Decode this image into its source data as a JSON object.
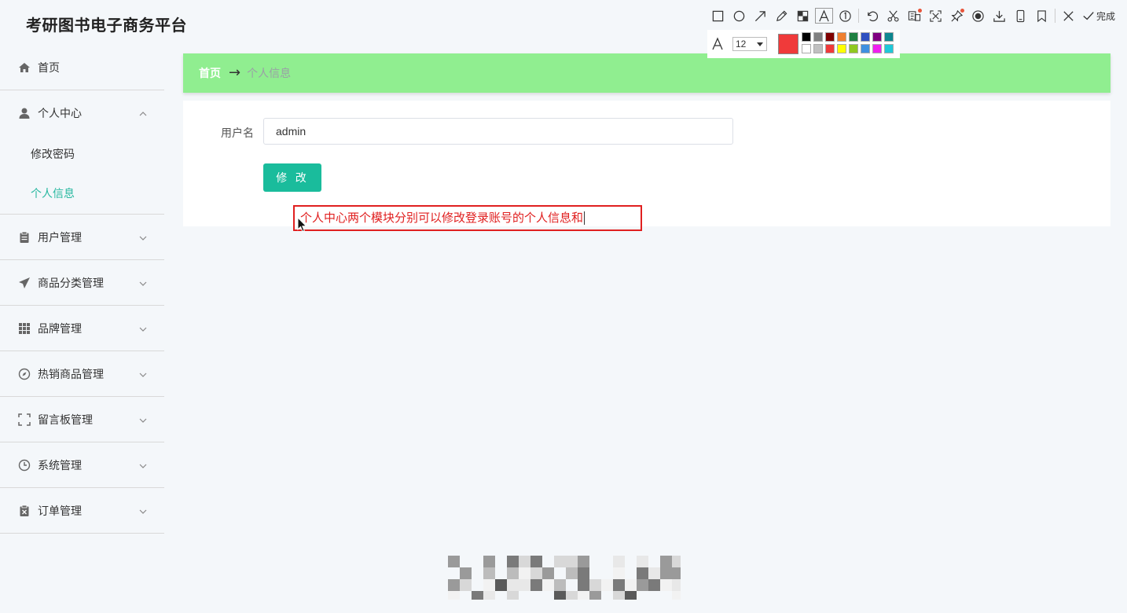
{
  "app": {
    "title": "考研图书电子商务平台"
  },
  "sidebar": {
    "items": [
      {
        "label": "首页",
        "icon": "home-icon"
      },
      {
        "label": "个人中心",
        "icon": "user-icon",
        "expanded": true,
        "children": [
          {
            "label": "修改密码"
          },
          {
            "label": "个人信息",
            "active": true
          }
        ]
      },
      {
        "label": "用户管理",
        "icon": "clipboard-icon"
      },
      {
        "label": "商品分类管理",
        "icon": "send-icon"
      },
      {
        "label": "品牌管理",
        "icon": "grid-icon"
      },
      {
        "label": "热销商品管理",
        "icon": "compass-icon"
      },
      {
        "label": "留言板管理",
        "icon": "frame-icon"
      },
      {
        "label": "系统管理",
        "icon": "clock-icon"
      },
      {
        "label": "订单管理",
        "icon": "order-icon"
      }
    ]
  },
  "breadcrumb": {
    "home": "首页",
    "separator": "→",
    "current": "个人信息"
  },
  "form": {
    "username_label": "用户名",
    "username_value": "admin",
    "submit_label": "修 改"
  },
  "annotation": {
    "text": "个人中心两个模块分别可以修改登录账号的个人信息和"
  },
  "toolbar": {
    "done_label": "完成",
    "font_size": "12",
    "current_color": "#f03a3a",
    "palette": [
      "#000000",
      "#808080",
      "#800000",
      "#f08030",
      "#208040",
      "#3050c0",
      "#800080",
      "#108890",
      "#ffffff",
      "#c0c0c0",
      "#f03a3a",
      "#ffff00",
      "#90c820",
      "#4090e0",
      "#f020f0",
      "#20c8d8"
    ]
  },
  "colors": {
    "accent": "#1abc9c",
    "breadcrumb_bg": "#90ee90",
    "active_link": "#28b8a0"
  }
}
